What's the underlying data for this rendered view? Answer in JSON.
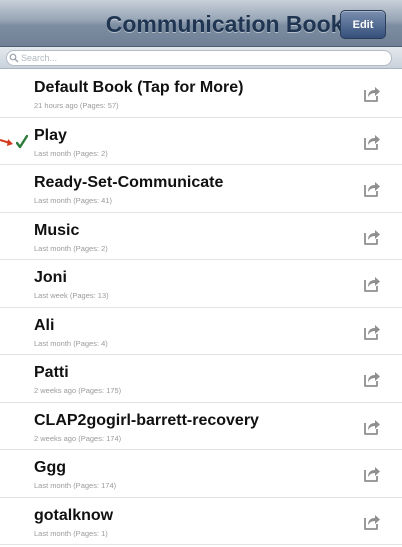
{
  "navbar": {
    "title": "Communication Books",
    "edit_label": "Edit"
  },
  "search": {
    "placeholder": "Search..."
  },
  "books": [
    {
      "name": "Default Book (Tap for More)",
      "detail": "21 hours ago (Pages: 57)"
    },
    {
      "name": "Play",
      "detail": "Last month (Pages: 2)",
      "selected": true
    },
    {
      "name": "Ready-Set-Communicate",
      "detail": "Last month (Pages: 41)"
    },
    {
      "name": "Music",
      "detail": "Last month (Pages: 2)"
    },
    {
      "name": "Joni",
      "detail": "Last week (Pages: 13)"
    },
    {
      "name": "Ali",
      "detail": "Last month (Pages: 4)"
    },
    {
      "name": "Patti",
      "detail": "2 weeks ago (Pages: 175)"
    },
    {
      "name": "CLAP2gogirl-barrett-recovery",
      "detail": "2 weeks ago (Pages: 174)"
    },
    {
      "name": "Ggg",
      "detail": "Last month (Pages: 174)"
    },
    {
      "name": "gotalknow",
      "detail": "Last month (Pages: 1)"
    }
  ],
  "icons": {
    "share": "share-arrow-icon",
    "selected": "checkmark-icon",
    "pointer": "red-arrow-icon",
    "search": "search-icon"
  },
  "colors": {
    "title_text": "#1f3552",
    "edit_button": "#344f7a",
    "checkmark": "#2a7a3a",
    "pointer_arrow": "#d23a1c"
  }
}
